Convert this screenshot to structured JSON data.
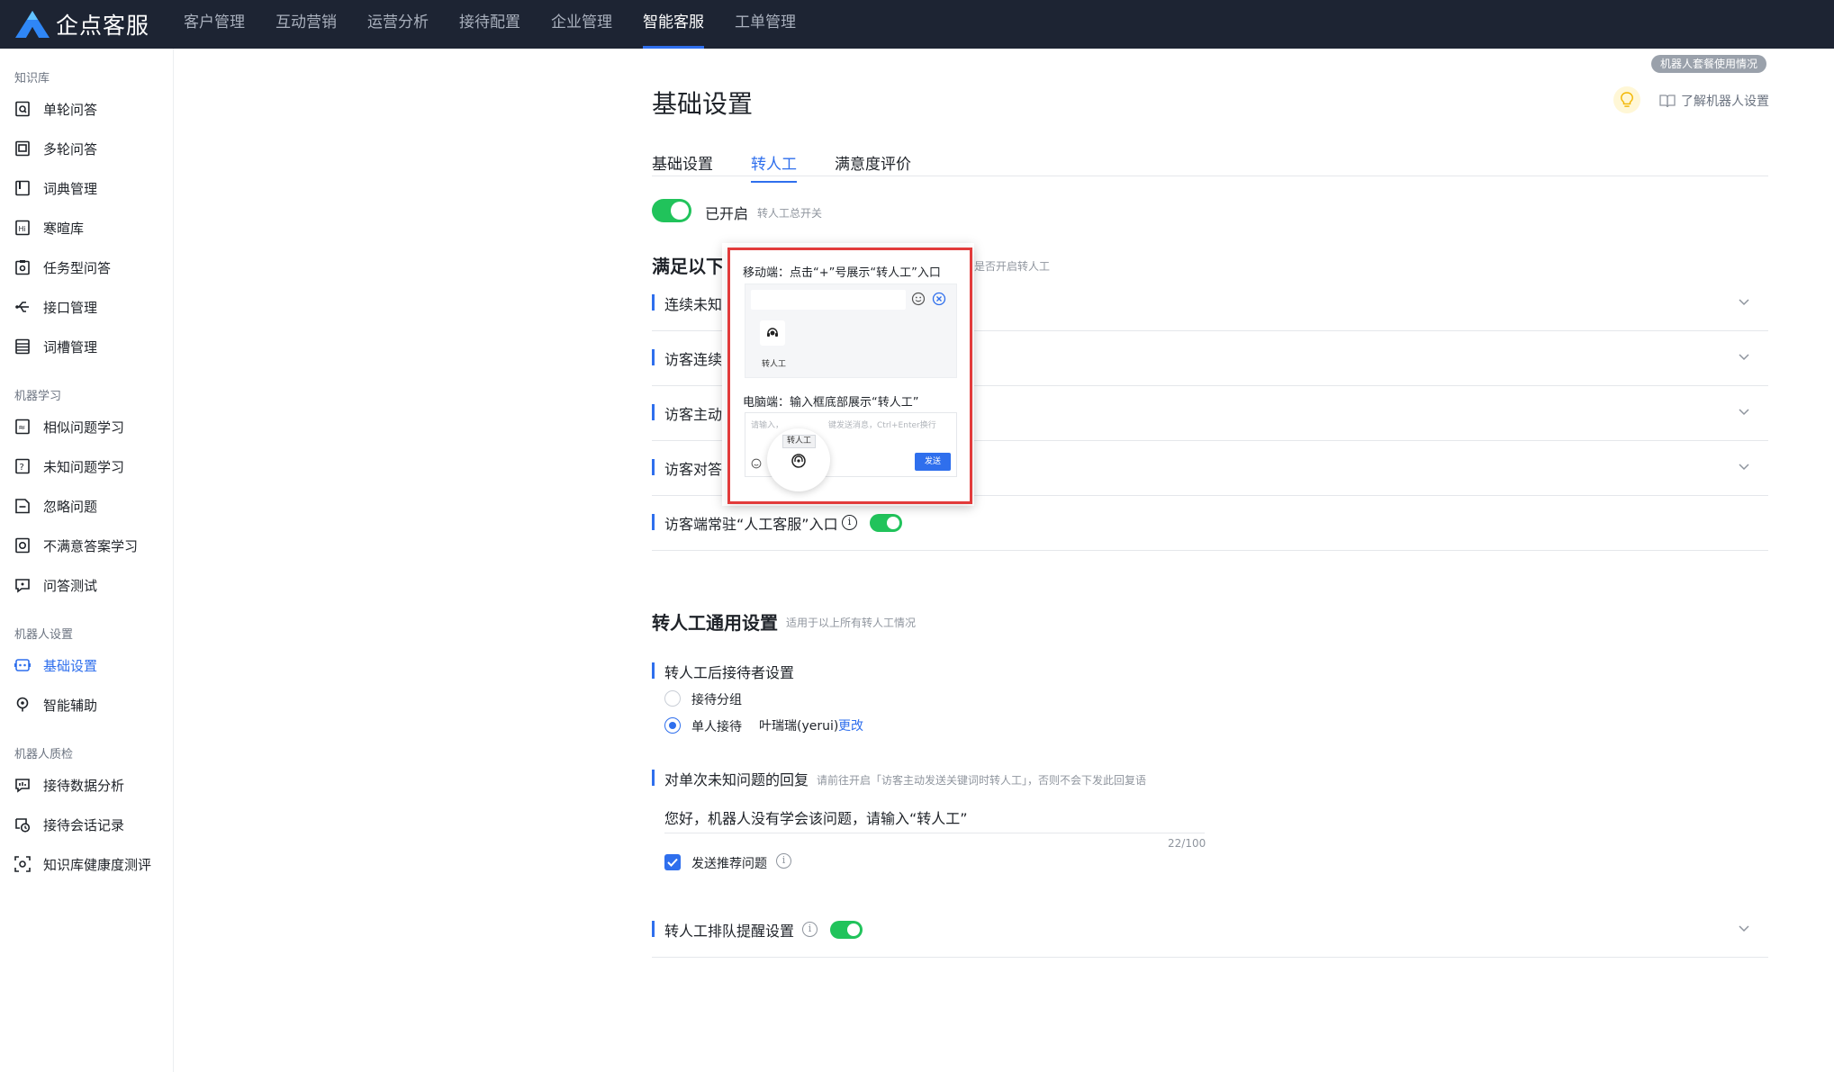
{
  "app": {
    "name": "企点客服"
  },
  "topnav": {
    "items": [
      "客户管理",
      "互动营销",
      "运营分析",
      "接待配置",
      "企业管理",
      "智能客服",
      "工单管理"
    ],
    "active": "智能客服"
  },
  "sidebar": {
    "groups": [
      {
        "title": "知识库",
        "items": [
          "单轮问答",
          "多轮问答",
          "词典管理",
          "寒暄库",
          "任务型问答",
          "接口管理",
          "词槽管理"
        ]
      },
      {
        "title": "机器学习",
        "items": [
          "相似问题学习",
          "未知问题学习",
          "忽略问题",
          "不满意答案学习",
          "问答测试"
        ]
      },
      {
        "title": "机器人设置",
        "items": [
          "基础设置",
          "智能辅助"
        ]
      },
      {
        "title": "机器人质检",
        "items": [
          "接待数据分析",
          "接待会话记录",
          "知识库健康度测评"
        ]
      }
    ],
    "active": "基础设置"
  },
  "header": {
    "usage_badge": "机器人套餐使用情况",
    "page_title": "基础设置",
    "learn_link": "了解机器人设置"
  },
  "tabs": [
    "基础设置",
    "转人工",
    "满意度评价"
  ],
  "active_tab": "转人工",
  "master_switch": {
    "label": "已开启",
    "hint": "转人工总开关",
    "on": true
  },
  "conditions": {
    "title_visible": "满足以下",
    "hint_visible": "是否开启转人工",
    "rows": [
      "连续未知",
      "访客连续",
      "访客主动",
      "访客对答"
    ],
    "entry_row": {
      "label": "访客端常驻“人工客服”入口",
      "on": true
    }
  },
  "popover": {
    "mobile_title": "移动端：点击“+”号展示“转人工”入口",
    "mobile_btn_label": "转人工",
    "pc_title": "电脑端：输入框底部展示“转人工”",
    "pc_placeholder": "请输入，",
    "pc_placeholder_tail": "键发送消息，Ctrl+Enter换行",
    "pc_tip": "转人工",
    "send": "发送"
  },
  "general": {
    "title": "转人工通用设置",
    "hint": "适用于以上所有转人工情况",
    "receiver": {
      "label": "转人工后接待者设置",
      "options": [
        "接待分组",
        "单人接待"
      ],
      "selected": "单人接待",
      "person": "叶瑞瑞(yerui)",
      "change": "更改"
    },
    "unknown_reply": {
      "label": "对单次未知问题的回复",
      "hint": "请前往开启「访客主动发送关键词时转人工」，否则不会下发此回复语",
      "value": "您好，机器人没有学会该问题，请输入“转人工”",
      "count": "22/100",
      "recommend_label": "发送推荐问题",
      "recommend_checked": true
    },
    "queue": {
      "label": "转人工排队提醒设置",
      "on": true
    }
  },
  "colors": {
    "primary": "#2f6fed",
    "switch_on": "#21c35b",
    "nav_bg": "#1d2433",
    "highlight": "#e23b3b"
  }
}
